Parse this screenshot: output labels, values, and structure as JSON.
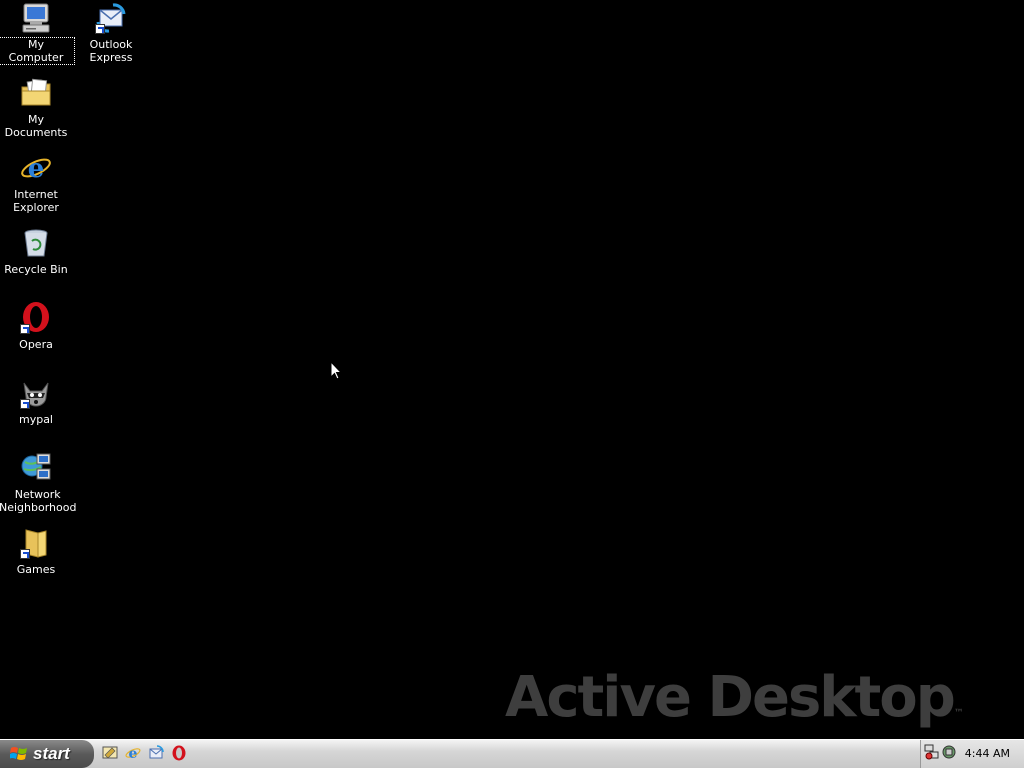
{
  "desktop": {
    "icons": [
      {
        "label": "My Computer",
        "icon": "my-computer-icon"
      },
      {
        "label": "Outlook Express",
        "icon": "outlook-express-icon"
      },
      {
        "label": "My Documents",
        "icon": "my-documents-icon"
      },
      {
        "label": "Internet Explorer",
        "icon": "internet-explorer-icon"
      },
      {
        "label": "Recycle Bin",
        "icon": "recycle-bin-icon"
      },
      {
        "label": "Opera",
        "icon": "opera-icon"
      },
      {
        "label": "mypal",
        "icon": "mypal-icon"
      },
      {
        "label": "Network Neighborhood",
        "icon": "network-neighborhood-icon"
      },
      {
        "label": "Games",
        "icon": "games-folder-icon"
      }
    ],
    "selected": "My Computer",
    "watermark": "Active Desktop",
    "watermark_mark": "™"
  },
  "taskbar": {
    "start_label": "start",
    "quick_launch": [
      "show-desktop-icon",
      "internet-explorer-icon",
      "outlook-express-icon",
      "opera-icon"
    ],
    "tray_icons": [
      "network-tray-icon",
      "volume-tray-icon"
    ],
    "clock": "4:44 AM"
  },
  "colors": {
    "desktop_background": "#000000",
    "watermark": "#3e3e3e",
    "taskbar": "#d6d6d6",
    "start_button": "#5a5a5a"
  }
}
